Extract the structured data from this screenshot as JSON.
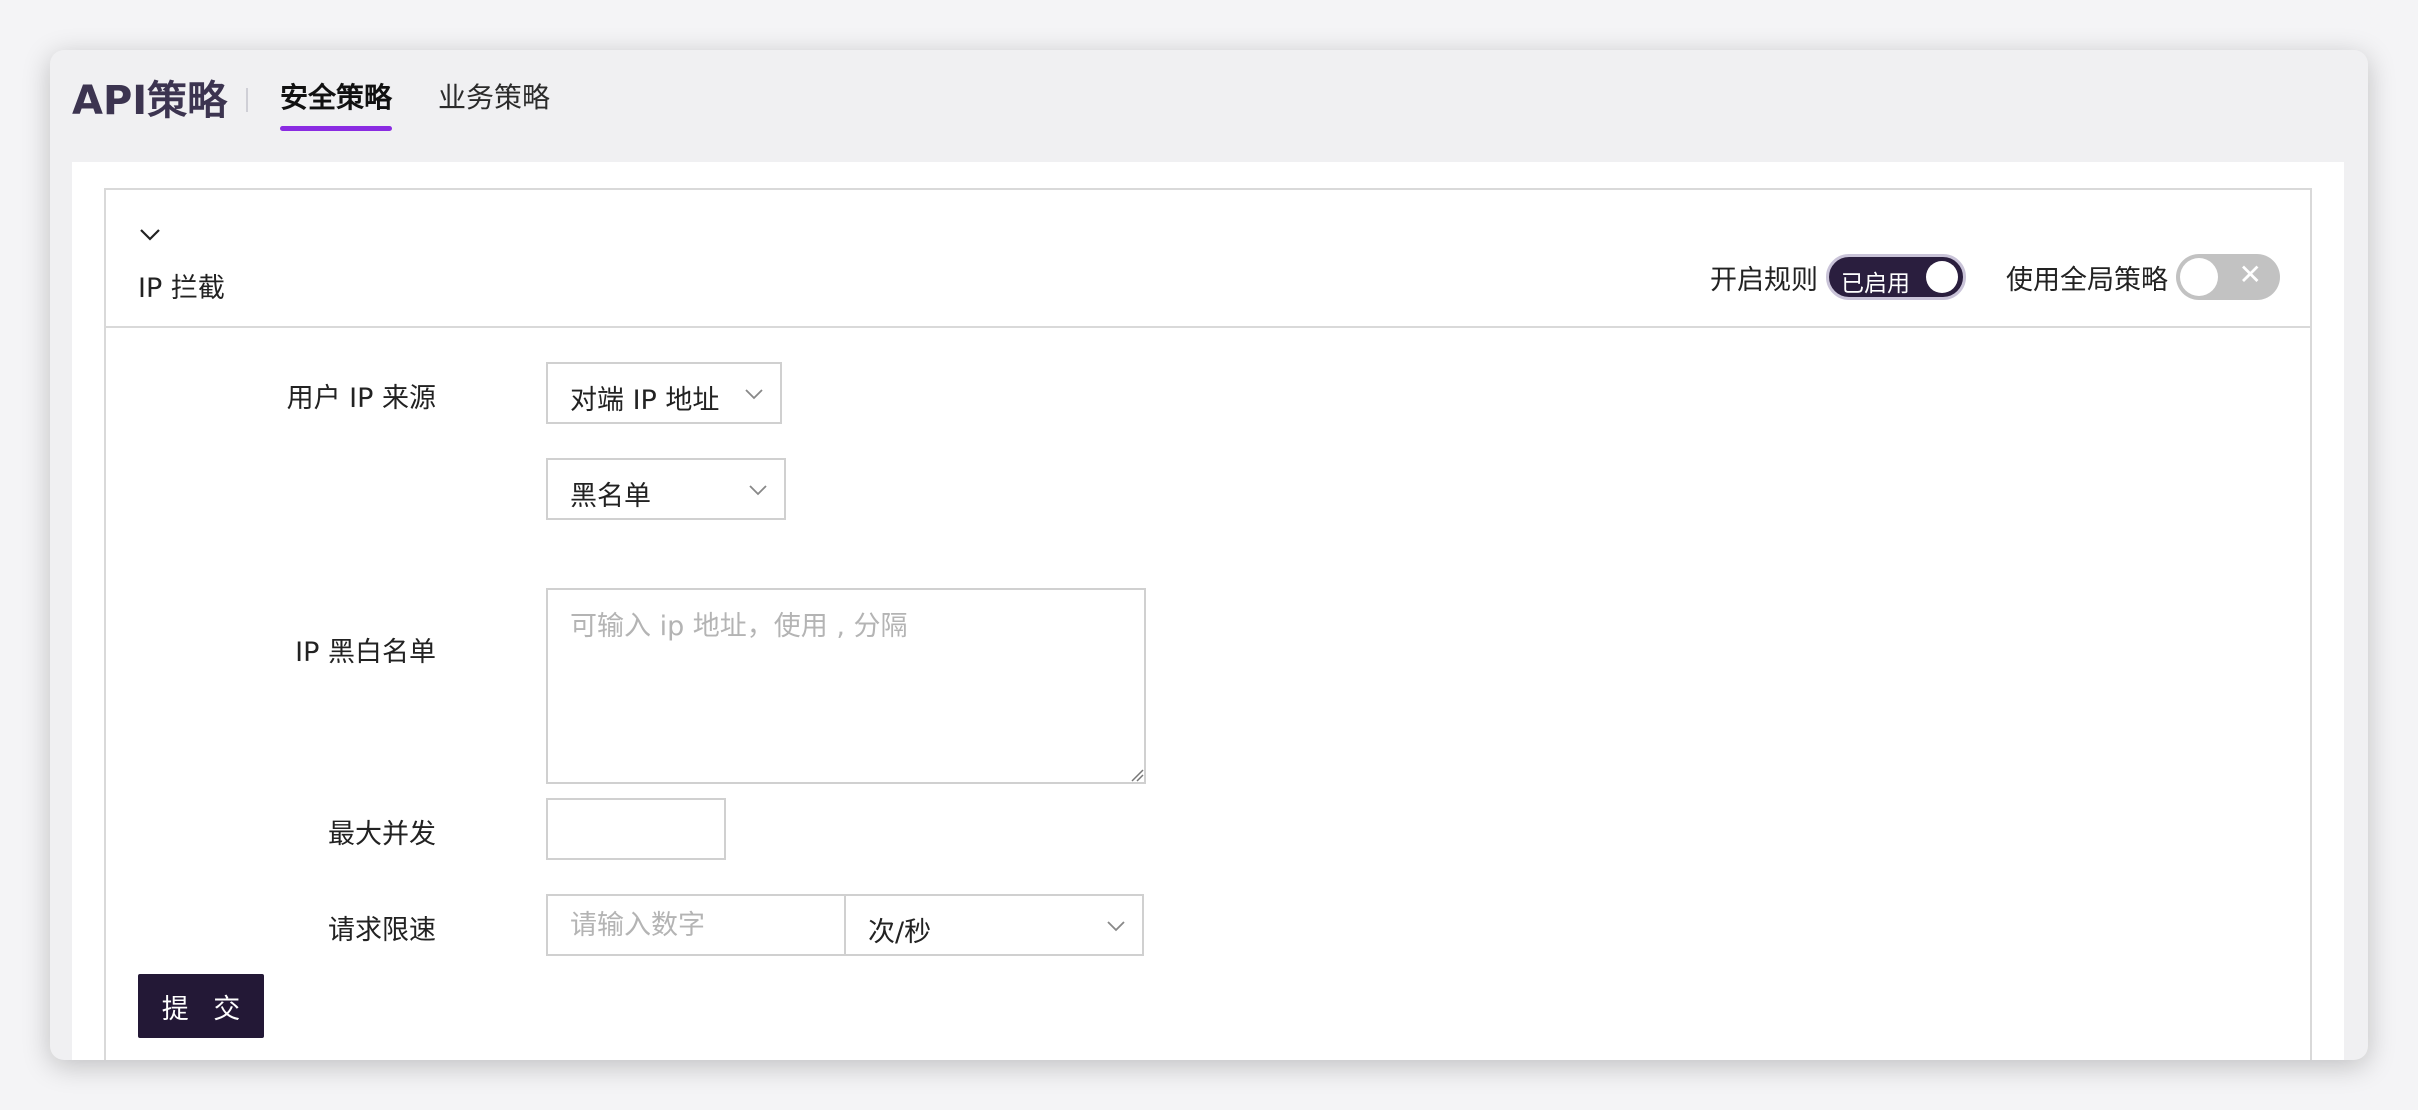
{
  "app": {
    "title": "API策略"
  },
  "tabs": [
    {
      "label": "安全策略",
      "active": true
    },
    {
      "label": "业务策略",
      "active": false
    }
  ],
  "section": {
    "title": "IP 拦截",
    "collapse_icon": "chevron-down-icon",
    "rule_toggle": {
      "label": "开启规则",
      "state_text": "已启用",
      "on": true
    },
    "global_toggle": {
      "label": "使用全局策略",
      "on": false,
      "off_icon": "close-icon"
    }
  },
  "form": {
    "ip_source": {
      "label": "用户 IP 来源",
      "value": "对端 IP 地址"
    },
    "list_type": {
      "value": "黑名单"
    },
    "ip_list": {
      "label": "IP 黑白名单",
      "placeholder": "可输入 ip 地址，使用 , 分隔",
      "value": ""
    },
    "max_concurrency": {
      "label": "最大并发",
      "value": ""
    },
    "rate_limit": {
      "label": "请求限速",
      "placeholder": "请输入数字",
      "unit": "次/秒"
    },
    "submit_label": "提 交"
  },
  "colors": {
    "accent": "#8a2be2",
    "primary_dark": "#231836",
    "toggle_on_bg": "#2a1e3e",
    "toggle_off_bg": "#c2c2c2"
  }
}
